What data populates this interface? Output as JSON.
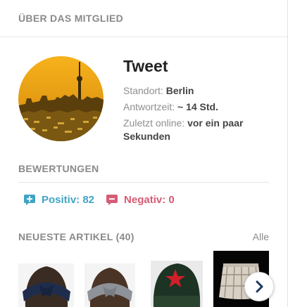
{
  "about": {
    "title": "ÜBER DAS MITGLIED"
  },
  "profile": {
    "name": "Tweet",
    "location_label": "Standort:",
    "location_value": "Berlin",
    "response_label": "Antwortzeit:",
    "response_value": "~ 14 Std.",
    "online_label": "Zuletzt online:",
    "online_value": "vor ein paar Sekunden"
  },
  "ratings": {
    "title": "BEWERTUNGEN",
    "positive": "Positiv: 82",
    "negative": "Negativ: 0"
  },
  "articles": {
    "title": "NEUESTE ARTIKEL (40)",
    "all_link": "Alle",
    "items": [
      {
        "icon": "navy-headband-thumbnail"
      },
      {
        "icon": "grey-headband-thumbnail"
      },
      {
        "icon": "beanie-with-red-star-thumbnail"
      },
      {
        "icon": "plaid-skirt-thumbnail"
      }
    ]
  },
  "colors": {
    "positive": "#3fa4c4",
    "negative": "#d55c75",
    "muted": "#8a8a8a"
  }
}
